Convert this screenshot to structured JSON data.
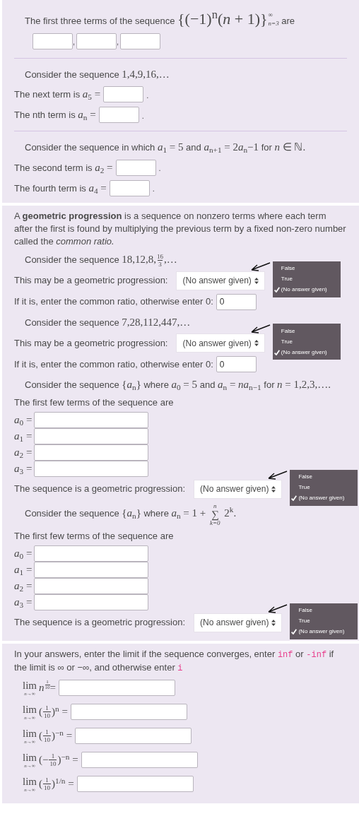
{
  "panels": [
    {
      "blocks": [
        {
          "kind": "intro",
          "parts": [
            {
              "kind": "text",
              "text": "The first three terms of the sequence "
            },
            {
              "kind": "script",
              "text": "{(−1)$^{n}$(*n* + 1)}",
              "sup": "∞",
              "sub": "n=3"
            },
            {
              "kind": "text",
              "text": " are"
            }
          ]
        },
        {
          "kind": "boxes",
          "inputs": [
            {
              "kind": "blank",
              "trailing": ","
            },
            {
              "kind": "blank",
              "trailing": ","
            },
            {
              "kind": "blank"
            }
          ]
        },
        {
          "kind": "divider"
        },
        {
          "kind": "intro",
          "parts": [
            {
              "kind": "text",
              "text": "Consider the sequence "
            },
            {
              "kind": "math",
              "text": "1,4,9,16,…"
            }
          ]
        },
        {
          "kind": "field",
          "label": [
            {
              "kind": "text",
              "text": "The next term is "
            },
            {
              "kind": "math",
              "text": "*a*$_{5}$ ="
            }
          ],
          "trailing": "."
        },
        {
          "kind": "field",
          "label": [
            {
              "kind": "text",
              "text": "The nth term is "
            },
            {
              "kind": "math",
              "text": "*a*$_{n}$ ="
            }
          ],
          "trailing": "."
        },
        {
          "kind": "divider"
        },
        {
          "kind": "intro",
          "parts": [
            {
              "kind": "text",
              "text": "Consider the sequence in which "
            },
            {
              "kind": "math",
              "text": "*a*$_{1}$ = 5"
            },
            {
              "kind": "text",
              "text": " and "
            },
            {
              "kind": "math",
              "text": "*a*$_{n+1}$ = 2"
            },
            {
              "kind": "math",
              "text": "*a*$_{n}$−1"
            },
            {
              "kind": "text",
              "text": " for "
            },
            {
              "kind": "math",
              "text": "*n* ∈ ℕ."
            }
          ]
        },
        {
          "kind": "field",
          "label": [
            {
              "kind": "text",
              "text": "The second term is "
            },
            {
              "kind": "math",
              "text": "*a*$_{2}$ ="
            }
          ],
          "trailing": "."
        },
        {
          "kind": "field",
          "label": [
            {
              "kind": "text",
              "text": "The fourth term is "
            },
            {
              "kind": "math",
              "text": "*a*$_{4}$ ="
            }
          ],
          "trailing": "."
        }
      ]
    },
    {
      "blocks": [
        {
          "kind": "text",
          "parts": [
            {
              "kind": "text",
              "text": "A **geometric progression** is a sequence on nonzero terms where each term after the first is found by multiplying the previous term by a fixed non-zero number called the *common ratio.*"
            }
          ]
        },
        {
          "kind": "intro",
          "parts": [
            {
              "kind": "text",
              "text": "Consider the sequence "
            },
            {
              "kind": "math",
              "text": "18,12,8,"
            },
            {
              "kind": "frac",
              "num": "16",
              "den": "3"
            },
            {
              "kind": "math",
              "text": ",…"
            }
          ]
        },
        {
          "kind": "select",
          "label": [
            {
              "kind": "text",
              "text": "This may be a geometric progression:"
            }
          ],
          "value": "(No answer given)",
          "options": [
            {
              "label": "False",
              "selected": false
            },
            {
              "label": "True",
              "selected": false
            },
            {
              "label": "(No answer given)",
              "selected": true
            }
          ]
        },
        {
          "kind": "field",
          "label": [
            {
              "kind": "text",
              "text": "If it is, enter the common ratio, otherwise enter 0:"
            }
          ],
          "value": "0"
        },
        {
          "kind": "intro",
          "parts": [
            {
              "kind": "text",
              "text": "Consider the sequence "
            },
            {
              "kind": "math",
              "text": "7,28,112,447,…"
            }
          ]
        },
        {
          "kind": "select",
          "label": [
            {
              "kind": "text",
              "text": "This may be a geometric progression:"
            }
          ],
          "value": "(No answer given)",
          "options": [
            {
              "label": "False",
              "selected": false
            },
            {
              "label": "True",
              "selected": false
            },
            {
              "label": "(No answer given)",
              "selected": true
            }
          ]
        },
        {
          "kind": "field",
          "label": [
            {
              "kind": "text",
              "text": "If it is, enter the common ratio, otherwise enter 0:"
            }
          ],
          "value": "0"
        },
        {
          "kind": "intro",
          "parts": [
            {
              "kind": "text",
              "text": "Consider the sequence "
            },
            {
              "kind": "math",
              "text": "{*a*$_{n}$}"
            },
            {
              "kind": "text",
              "text": " where "
            },
            {
              "kind": "math",
              "text": "*a*$_{0}$ = 5"
            },
            {
              "kind": "text",
              "text": " and "
            },
            {
              "kind": "math",
              "text": "*a*$_{n}$ = *na*$_{n−1}$"
            },
            {
              "kind": "text",
              "text": " for "
            },
            {
              "kind": "math",
              "text": "*n* = 1,2,3,…."
            }
          ]
        },
        {
          "kind": "text",
          "parts": [
            {
              "kind": "text",
              "text": "The first few terms of the sequence are"
            }
          ]
        },
        {
          "kind": "stack",
          "rows": [
            {
              "label": [
                {
                  "kind": "math",
                  "text": "*a*$_{0}$ ="
                }
              ]
            },
            {
              "label": [
                {
                  "kind": "math",
                  "text": "*a*$_{1}$ ="
                }
              ]
            },
            {
              "label": [
                {
                  "kind": "math",
                  "text": "*a*$_{2}$ ="
                }
              ]
            },
            {
              "label": [
                {
                  "kind": "math",
                  "text": "*a*$_{3}$ ="
                }
              ]
            }
          ]
        },
        {
          "kind": "select",
          "label": [
            {
              "kind": "text",
              "text": "The sequence is a geometric progression:"
            }
          ],
          "value": "(No answer given)",
          "options": [
            {
              "label": "False",
              "selected": false
            },
            {
              "label": "True",
              "selected": false
            },
            {
              "label": "(No answer given)",
              "selected": true
            }
          ]
        },
        {
          "kind": "intro",
          "parts": [
            {
              "kind": "text",
              "text": "Consider the sequence "
            },
            {
              "kind": "math",
              "text": "{*a*$_{n}$}"
            },
            {
              "kind": "text",
              "text": " where "
            },
            {
              "kind": "math",
              "text": "*a*$_{n}$ = 1 + "
            },
            {
              "kind": "sum",
              "symbol": "∑",
              "over": "n",
              "under": "k=0"
            },
            {
              "kind": "math",
              "text": " 2$^{k}$."
            }
          ]
        },
        {
          "kind": "text",
          "parts": [
            {
              "kind": "text",
              "text": "The first few terms of the sequence are"
            }
          ]
        },
        {
          "kind": "stack",
          "rows": [
            {
              "label": [
                {
                  "kind": "math",
                  "text": "*a*$_{0}$ ="
                }
              ]
            },
            {
              "label": [
                {
                  "kind": "math",
                  "text": "*a*$_{1}$ ="
                }
              ]
            },
            {
              "label": [
                {
                  "kind": "math",
                  "text": "*a*$_{2}$ ="
                }
              ]
            },
            {
              "label": [
                {
                  "kind": "math",
                  "text": "*a*$_{3}$ ="
                }
              ]
            }
          ]
        },
        {
          "kind": "select",
          "label": [
            {
              "kind": "text",
              "text": "The sequence is a geometric progression:"
            }
          ],
          "value": "(No answer given)",
          "options": [
            {
              "label": "False",
              "selected": false
            },
            {
              "label": "True",
              "selected": false
            },
            {
              "label": "(No answer given)",
              "selected": true
            }
          ]
        }
      ]
    },
    {
      "blocks": [
        {
          "kind": "text",
          "parts": [
            {
              "kind": "text",
              "text": "In your answers, enter the limit if the sequence converges, enter "
            },
            {
              "kind": "code",
              "text": "inf"
            },
            {
              "kind": "text",
              "text": " or "
            },
            {
              "kind": "code",
              "text": "-inf"
            },
            {
              "kind": "text",
              "text": " if the limit is ∞ or −∞, and otherwise enter "
            },
            {
              "kind": "code",
              "text": "i"
            }
          ]
        },
        {
          "kind": "limit",
          "operator": "lim",
          "under": "n→∞",
          "expr": [
            {
              "kind": "powfrac",
              "base": "n",
              "num": "1",
              "den": "10"
            },
            {
              "kind": "math",
              "text": " ="
            }
          ]
        },
        {
          "kind": "limit",
          "operator": "lim",
          "under": "n→∞",
          "expr": [
            {
              "kind": "math",
              "text": "("
            },
            {
              "kind": "frac",
              "num": "1",
              "den": "10"
            },
            {
              "kind": "math",
              "text": ")$^{n}$ ="
            }
          ]
        },
        {
          "kind": "limit",
          "operator": "lim",
          "under": "n→∞",
          "expr": [
            {
              "kind": "math",
              "text": "("
            },
            {
              "kind": "frac",
              "num": "1",
              "den": "10"
            },
            {
              "kind": "math",
              "text": ")$^{−n}$ ="
            }
          ]
        },
        {
          "kind": "limit",
          "operator": "lim",
          "under": "n→∞",
          "expr": [
            {
              "kind": "math",
              "text": "(−"
            },
            {
              "kind": "frac",
              "num": "1",
              "den": "10"
            },
            {
              "kind": "math",
              "text": ")$^{−n}$ ="
            }
          ]
        },
        {
          "kind": "limit",
          "operator": "lim",
          "under": "n→∞",
          "expr": [
            {
              "kind": "math",
              "text": "("
            },
            {
              "kind": "frac",
              "num": "1",
              "den": "10"
            },
            {
              "kind": "math",
              "text": ")$^{1/n}$ ="
            }
          ]
        }
      ]
    }
  ]
}
